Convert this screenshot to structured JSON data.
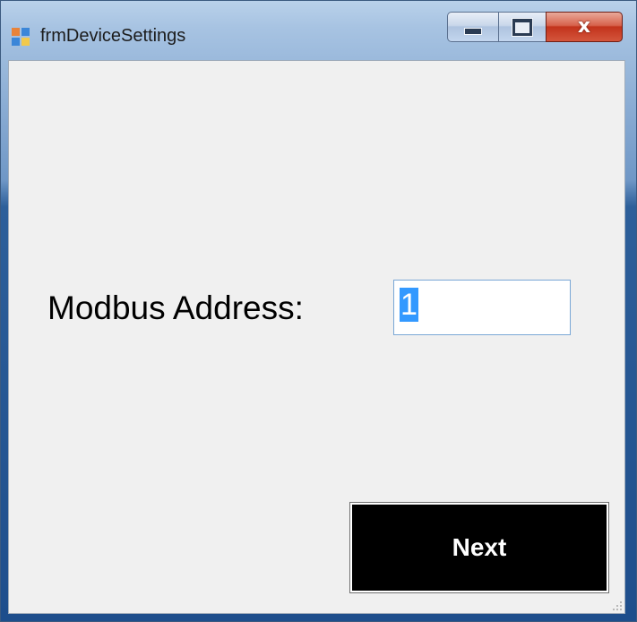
{
  "window": {
    "title": "frmDeviceSettings",
    "icon": "form-icon"
  },
  "caption_buttons": {
    "minimize": "minimize-icon",
    "maximize": "maximize-icon",
    "close": "close-icon",
    "close_glyph": "x"
  },
  "form": {
    "modbus_label": "Modbus Address:",
    "modbus_value": "1",
    "next_label": "Next"
  },
  "colors": {
    "close_button": "#c2331c",
    "next_button_bg": "#000000",
    "selection": "#3399ff"
  }
}
